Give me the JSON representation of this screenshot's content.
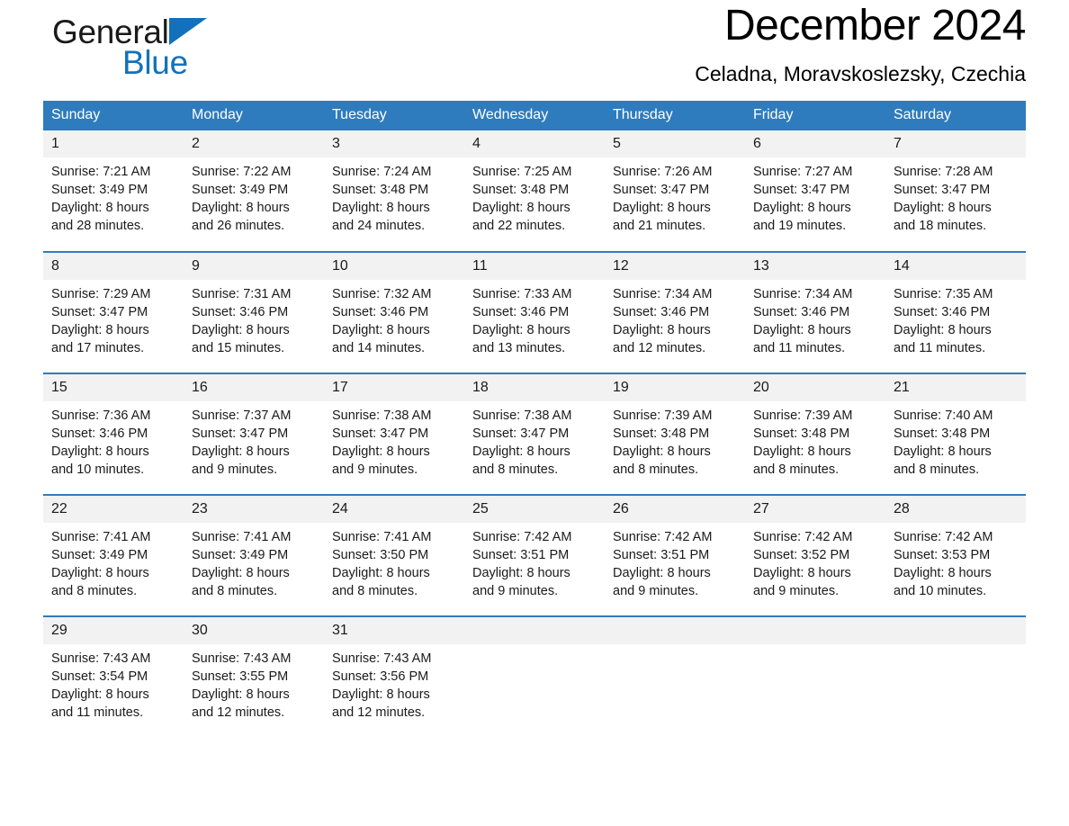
{
  "brand": {
    "name_part1": "General",
    "name_part2": "Blue",
    "triangle_color": "#1271ba"
  },
  "header": {
    "month_title": "December 2024",
    "location": "Celadna, Moravskoslezsky, Czechia"
  },
  "theme": {
    "accent": "#2e7cbd",
    "daynum_bg": "#f2f2f2",
    "text": "#1a1a1a"
  },
  "calendar": {
    "weekday_headers": [
      "Sunday",
      "Monday",
      "Tuesday",
      "Wednesday",
      "Thursday",
      "Friday",
      "Saturday"
    ],
    "weeks": [
      [
        {
          "day": "1",
          "sunrise": "Sunrise: 7:21 AM",
          "sunset": "Sunset: 3:49 PM",
          "daylight_line1": "Daylight: 8 hours",
          "daylight_line2": "and 28 minutes."
        },
        {
          "day": "2",
          "sunrise": "Sunrise: 7:22 AM",
          "sunset": "Sunset: 3:49 PM",
          "daylight_line1": "Daylight: 8 hours",
          "daylight_line2": "and 26 minutes."
        },
        {
          "day": "3",
          "sunrise": "Sunrise: 7:24 AM",
          "sunset": "Sunset: 3:48 PM",
          "daylight_line1": "Daylight: 8 hours",
          "daylight_line2": "and 24 minutes."
        },
        {
          "day": "4",
          "sunrise": "Sunrise: 7:25 AM",
          "sunset": "Sunset: 3:48 PM",
          "daylight_line1": "Daylight: 8 hours",
          "daylight_line2": "and 22 minutes."
        },
        {
          "day": "5",
          "sunrise": "Sunrise: 7:26 AM",
          "sunset": "Sunset: 3:47 PM",
          "daylight_line1": "Daylight: 8 hours",
          "daylight_line2": "and 21 minutes."
        },
        {
          "day": "6",
          "sunrise": "Sunrise: 7:27 AM",
          "sunset": "Sunset: 3:47 PM",
          "daylight_line1": "Daylight: 8 hours",
          "daylight_line2": "and 19 minutes."
        },
        {
          "day": "7",
          "sunrise": "Sunrise: 7:28 AM",
          "sunset": "Sunset: 3:47 PM",
          "daylight_line1": "Daylight: 8 hours",
          "daylight_line2": "and 18 minutes."
        }
      ],
      [
        {
          "day": "8",
          "sunrise": "Sunrise: 7:29 AM",
          "sunset": "Sunset: 3:47 PM",
          "daylight_line1": "Daylight: 8 hours",
          "daylight_line2": "and 17 minutes."
        },
        {
          "day": "9",
          "sunrise": "Sunrise: 7:31 AM",
          "sunset": "Sunset: 3:46 PM",
          "daylight_line1": "Daylight: 8 hours",
          "daylight_line2": "and 15 minutes."
        },
        {
          "day": "10",
          "sunrise": "Sunrise: 7:32 AM",
          "sunset": "Sunset: 3:46 PM",
          "daylight_line1": "Daylight: 8 hours",
          "daylight_line2": "and 14 minutes."
        },
        {
          "day": "11",
          "sunrise": "Sunrise: 7:33 AM",
          "sunset": "Sunset: 3:46 PM",
          "daylight_line1": "Daylight: 8 hours",
          "daylight_line2": "and 13 minutes."
        },
        {
          "day": "12",
          "sunrise": "Sunrise: 7:34 AM",
          "sunset": "Sunset: 3:46 PM",
          "daylight_line1": "Daylight: 8 hours",
          "daylight_line2": "and 12 minutes."
        },
        {
          "day": "13",
          "sunrise": "Sunrise: 7:34 AM",
          "sunset": "Sunset: 3:46 PM",
          "daylight_line1": "Daylight: 8 hours",
          "daylight_line2": "and 11 minutes."
        },
        {
          "day": "14",
          "sunrise": "Sunrise: 7:35 AM",
          "sunset": "Sunset: 3:46 PM",
          "daylight_line1": "Daylight: 8 hours",
          "daylight_line2": "and 11 minutes."
        }
      ],
      [
        {
          "day": "15",
          "sunrise": "Sunrise: 7:36 AM",
          "sunset": "Sunset: 3:46 PM",
          "daylight_line1": "Daylight: 8 hours",
          "daylight_line2": "and 10 minutes."
        },
        {
          "day": "16",
          "sunrise": "Sunrise: 7:37 AM",
          "sunset": "Sunset: 3:47 PM",
          "daylight_line1": "Daylight: 8 hours",
          "daylight_line2": "and 9 minutes."
        },
        {
          "day": "17",
          "sunrise": "Sunrise: 7:38 AM",
          "sunset": "Sunset: 3:47 PM",
          "daylight_line1": "Daylight: 8 hours",
          "daylight_line2": "and 9 minutes."
        },
        {
          "day": "18",
          "sunrise": "Sunrise: 7:38 AM",
          "sunset": "Sunset: 3:47 PM",
          "daylight_line1": "Daylight: 8 hours",
          "daylight_line2": "and 8 minutes."
        },
        {
          "day": "19",
          "sunrise": "Sunrise: 7:39 AM",
          "sunset": "Sunset: 3:48 PM",
          "daylight_line1": "Daylight: 8 hours",
          "daylight_line2": "and 8 minutes."
        },
        {
          "day": "20",
          "sunrise": "Sunrise: 7:39 AM",
          "sunset": "Sunset: 3:48 PM",
          "daylight_line1": "Daylight: 8 hours",
          "daylight_line2": "and 8 minutes."
        },
        {
          "day": "21",
          "sunrise": "Sunrise: 7:40 AM",
          "sunset": "Sunset: 3:48 PM",
          "daylight_line1": "Daylight: 8 hours",
          "daylight_line2": "and 8 minutes."
        }
      ],
      [
        {
          "day": "22",
          "sunrise": "Sunrise: 7:41 AM",
          "sunset": "Sunset: 3:49 PM",
          "daylight_line1": "Daylight: 8 hours",
          "daylight_line2": "and 8 minutes."
        },
        {
          "day": "23",
          "sunrise": "Sunrise: 7:41 AM",
          "sunset": "Sunset: 3:49 PM",
          "daylight_line1": "Daylight: 8 hours",
          "daylight_line2": "and 8 minutes."
        },
        {
          "day": "24",
          "sunrise": "Sunrise: 7:41 AM",
          "sunset": "Sunset: 3:50 PM",
          "daylight_line1": "Daylight: 8 hours",
          "daylight_line2": "and 8 minutes."
        },
        {
          "day": "25",
          "sunrise": "Sunrise: 7:42 AM",
          "sunset": "Sunset: 3:51 PM",
          "daylight_line1": "Daylight: 8 hours",
          "daylight_line2": "and 9 minutes."
        },
        {
          "day": "26",
          "sunrise": "Sunrise: 7:42 AM",
          "sunset": "Sunset: 3:51 PM",
          "daylight_line1": "Daylight: 8 hours",
          "daylight_line2": "and 9 minutes."
        },
        {
          "day": "27",
          "sunrise": "Sunrise: 7:42 AM",
          "sunset": "Sunset: 3:52 PM",
          "daylight_line1": "Daylight: 8 hours",
          "daylight_line2": "and 9 minutes."
        },
        {
          "day": "28",
          "sunrise": "Sunrise: 7:42 AM",
          "sunset": "Sunset: 3:53 PM",
          "daylight_line1": "Daylight: 8 hours",
          "daylight_line2": "and 10 minutes."
        }
      ],
      [
        {
          "day": "29",
          "sunrise": "Sunrise: 7:43 AM",
          "sunset": "Sunset: 3:54 PM",
          "daylight_line1": "Daylight: 8 hours",
          "daylight_line2": "and 11 minutes."
        },
        {
          "day": "30",
          "sunrise": "Sunrise: 7:43 AM",
          "sunset": "Sunset: 3:55 PM",
          "daylight_line1": "Daylight: 8 hours",
          "daylight_line2": "and 12 minutes."
        },
        {
          "day": "31",
          "sunrise": "Sunrise: 7:43 AM",
          "sunset": "Sunset: 3:56 PM",
          "daylight_line1": "Daylight: 8 hours",
          "daylight_line2": "and 12 minutes."
        },
        {
          "day": "",
          "sunrise": "",
          "sunset": "",
          "daylight_line1": "",
          "daylight_line2": ""
        },
        {
          "day": "",
          "sunrise": "",
          "sunset": "",
          "daylight_line1": "",
          "daylight_line2": ""
        },
        {
          "day": "",
          "sunrise": "",
          "sunset": "",
          "daylight_line1": "",
          "daylight_line2": ""
        },
        {
          "day": "",
          "sunrise": "",
          "sunset": "",
          "daylight_line1": "",
          "daylight_line2": ""
        }
      ]
    ]
  }
}
